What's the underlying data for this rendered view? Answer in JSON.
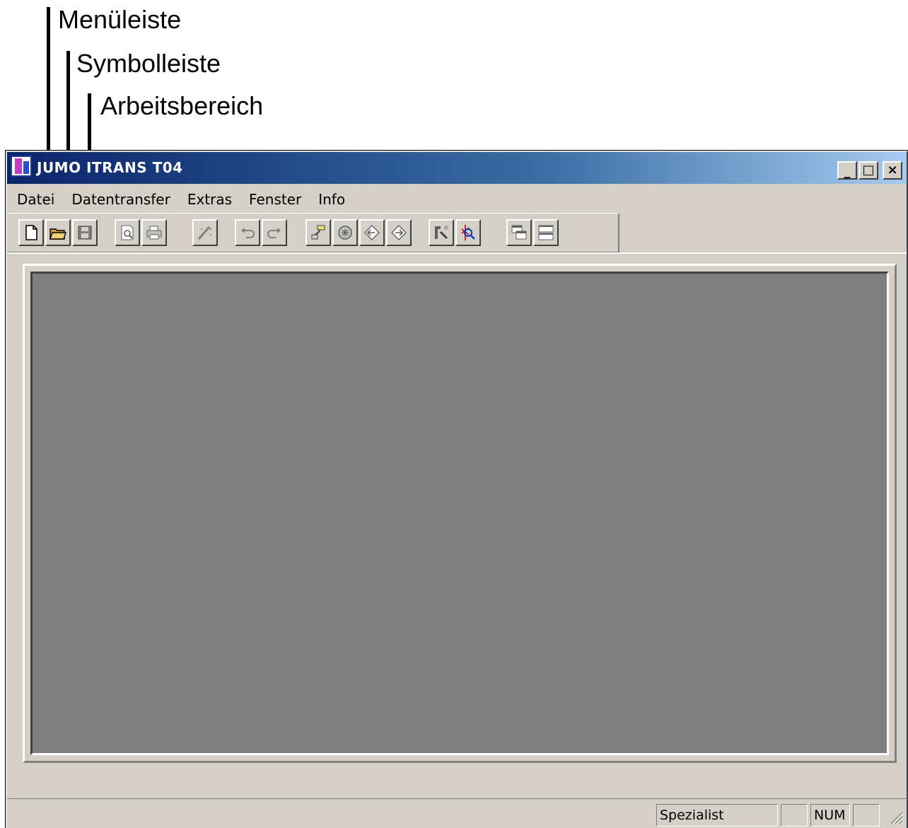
{
  "callouts": [
    {
      "label": "Menüleiste"
    },
    {
      "label": "Symbolleiste"
    },
    {
      "label": "Arbeitsbereich"
    }
  ],
  "window": {
    "title": "JUMO ITRANS T04",
    "icon": "app-icon",
    "caption_buttons": {
      "minimize": "_",
      "maximize": "□",
      "close": "×"
    }
  },
  "menu": {
    "items": [
      "Datei",
      "Datentransfer",
      "Extras",
      "Fenster",
      "Info"
    ]
  },
  "toolbar": {
    "buttons": [
      {
        "name": "new-document-icon"
      },
      {
        "name": "open-folder-icon"
      },
      {
        "name": "save-icon"
      },
      {
        "name": "print-preview-icon"
      },
      {
        "name": "print-icon"
      },
      {
        "name": "wizard-icon"
      },
      {
        "name": "undo-icon"
      },
      {
        "name": "redo-icon"
      },
      {
        "name": "connection-icon"
      },
      {
        "name": "device-icon"
      },
      {
        "name": "receive-icon"
      },
      {
        "name": "send-icon"
      },
      {
        "name": "tool-icon"
      },
      {
        "name": "search-icon"
      },
      {
        "name": "cascade-icon"
      },
      {
        "name": "tile-icon"
      }
    ]
  },
  "statusbar": {
    "user_level": "Spezialist",
    "caps": "",
    "num": "NUM",
    "scroll": ""
  },
  "colors": {
    "title_start": "#0a246a",
    "title_end": "#a6caf0",
    "face": "#d4d0c8",
    "workspace": "#808080"
  }
}
